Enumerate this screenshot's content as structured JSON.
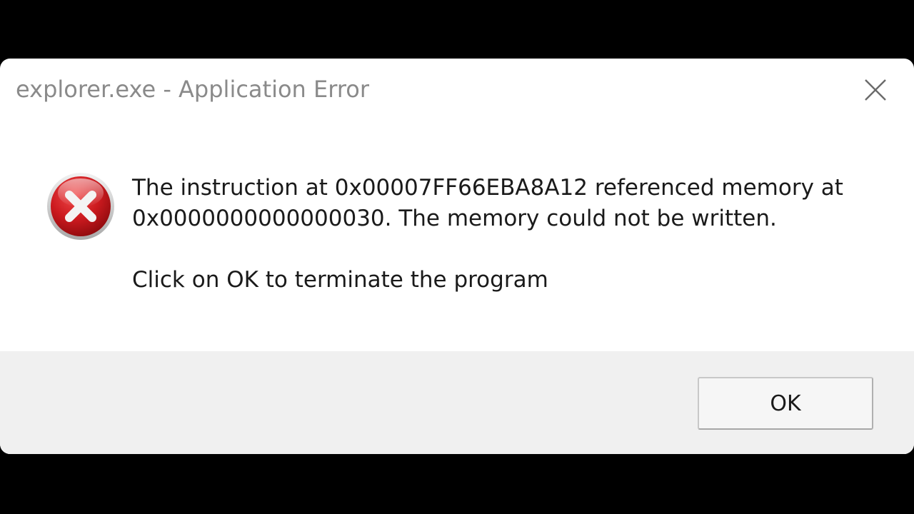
{
  "window": {
    "title": "explorer.exe - Application Error"
  },
  "icons": {
    "close": "close-icon",
    "error": "error-icon"
  },
  "message": {
    "line1": "The instruction at 0x00007FF66EBA8A12 referenced memory at",
    "line2": "0x0000000000000030. The memory could not be written.",
    "instruction": "Click on OK to terminate the program"
  },
  "buttons": {
    "ok_label": "OK"
  },
  "colors": {
    "error_red": "#c4161c",
    "footer_bg": "#f0f0f0",
    "title_text": "#8a8a8a"
  }
}
